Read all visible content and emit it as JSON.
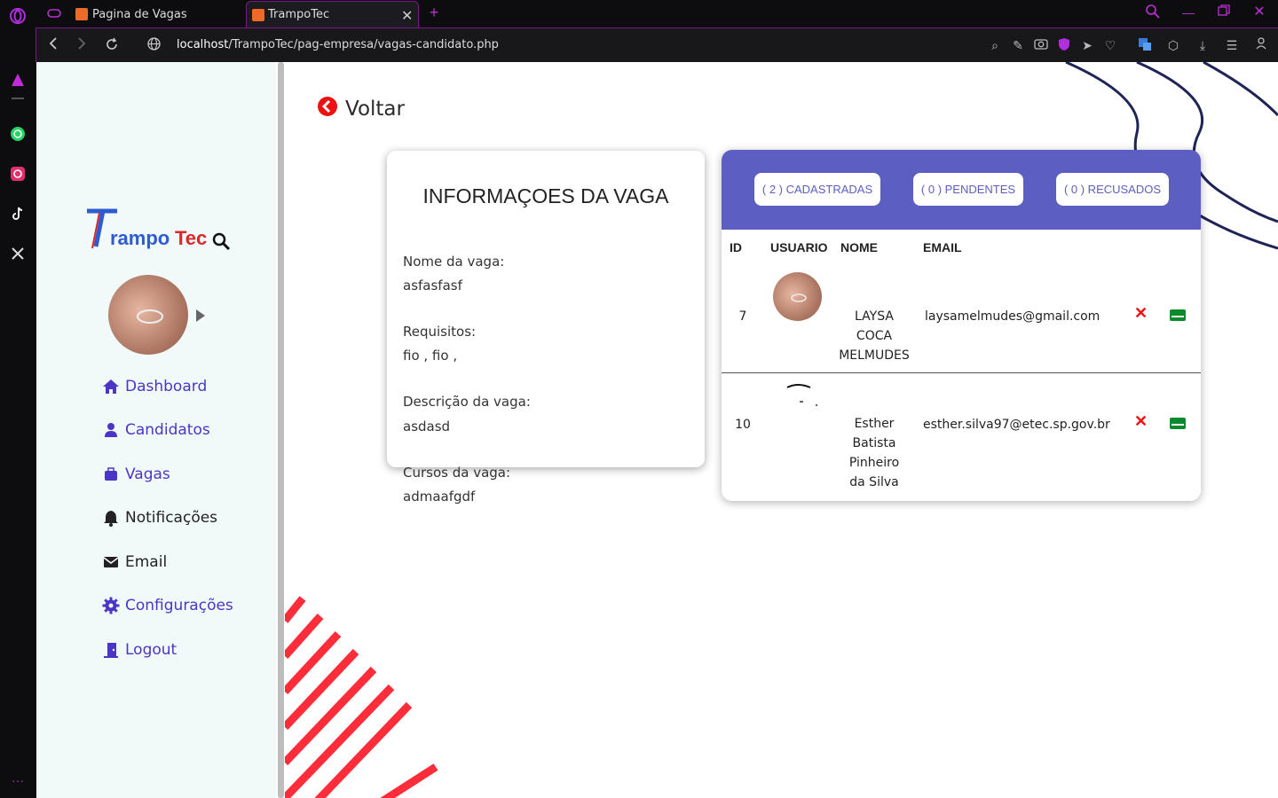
{
  "browser": {
    "tabs": [
      {
        "title": "Pagina de Vagas"
      },
      {
        "title": "TrampoTec"
      }
    ],
    "url_host": "localhost",
    "url_path": "/TrampoTec/pag-empresa/vagas-candidato.php"
  },
  "colors": {
    "accent": "#5c5fc1",
    "nav": "#4b35c6",
    "danger": "#e11111",
    "success": "#0a8a2a",
    "sidebar_bg": "#f1faf8"
  },
  "back": {
    "label": "Voltar"
  },
  "sidebar": {
    "logo_text": "TrampoTec",
    "items": [
      {
        "label": "Dashboard",
        "icon": "home-icon"
      },
      {
        "label": "Candidatos",
        "icon": "user-icon"
      },
      {
        "label": "Vagas",
        "icon": "briefcase-icon"
      },
      {
        "label": "Notificações",
        "icon": "bell-icon"
      },
      {
        "label": "Email",
        "icon": "envelope-icon"
      },
      {
        "label": "Configurações",
        "icon": "gear-icon"
      },
      {
        "label": "Logout",
        "icon": "door-icon"
      }
    ]
  },
  "info": {
    "title": "INFORMAÇOES DA VAGA",
    "nome_label": "Nome da vaga:",
    "nome_value": "asfasfasf",
    "requisitos_label": "Requisitos:",
    "requisitos_value": "fio , fio ,",
    "descricao_label": "Descrição da vaga:",
    "descricao_value": "asdasd",
    "cursos_label": "Cursos da vaga:",
    "cursos_value": "admaafgdf"
  },
  "candidates": {
    "filters": [
      {
        "label": "( 2 ) CADASTRADAS"
      },
      {
        "label": "( 0 ) PENDENTES"
      },
      {
        "label": "( 0 ) RECUSADOS"
      }
    ],
    "columns": [
      "ID",
      "USUARIO",
      "NOME",
      "EMAIL"
    ],
    "rows": [
      {
        "id": "7",
        "name_lines": [
          "LAYSA",
          "COCA",
          "MELMUDES"
        ],
        "email": "laysamelmudes@gmail.com"
      },
      {
        "id": "10",
        "name_lines": [
          "Esther",
          "Batista",
          "Pinheiro",
          "da Silva"
        ],
        "email": "esther.silva97@etec.sp.gov.br"
      }
    ]
  }
}
